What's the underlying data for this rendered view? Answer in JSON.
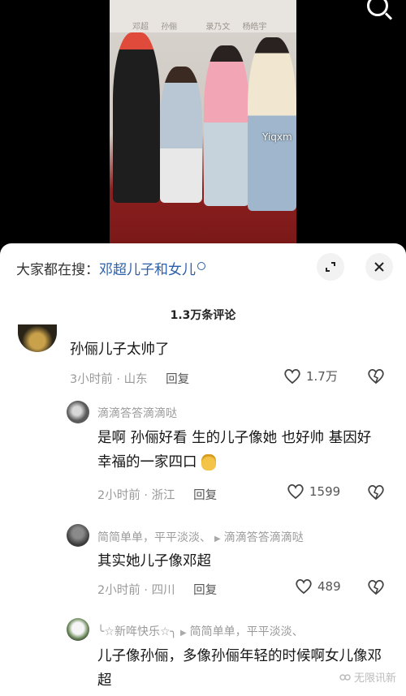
{
  "video": {
    "backdrop_words": [
      "邓超",
      "孙俪"
    ],
    "credit_1": "录乃文",
    "credit_2": "杨皓宇",
    "watermark": "Yiqxm"
  },
  "search_bar": {
    "prefix": "大家都在搜：",
    "query": "邓超儿子和女儿",
    "expand_icon": "expand-icon",
    "close_icon": "close-icon"
  },
  "comments_count": "1.3万条评论",
  "comments": [
    {
      "text": "孙俪儿子太帅了",
      "time": "3小时前",
      "location": "山东",
      "reply_label": "回复",
      "likes": "1.7万"
    },
    {
      "username": "滴滴答答滴滴哒",
      "text": "是啊 孙俪好看 生的儿子像她 也好帅 基因好 幸福的一家四口",
      "time": "2小时前",
      "location": "浙江",
      "reply_label": "回复",
      "likes": "1599"
    },
    {
      "username": "简简单单，平平淡淡、",
      "reply_to": "滴滴答答滴滴哒",
      "text": "其实她儿子像邓超",
      "time": "2小时前",
      "location": "四川",
      "reply_label": "回复",
      "likes": "489"
    },
    {
      "username": "╰☆新哖快乐☆╮",
      "reply_to": "简简单单，平平淡淡、",
      "text": "儿子像孙俪，多像孙俪年轻的时候啊女儿像邓超"
    }
  ],
  "meta_separator": "·",
  "bottom_watermark": "无限讯新"
}
